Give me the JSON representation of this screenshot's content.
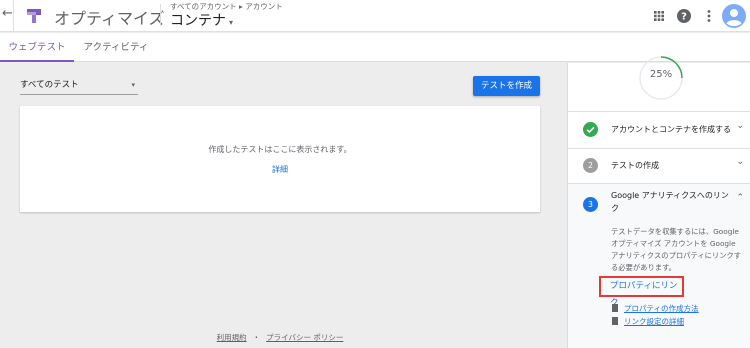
{
  "header": {
    "back_icon": "←",
    "brand": "オプティマイズ",
    "breadcrumb": "すべてのアカウント ▸ アカウント",
    "container_name": "コンテナ",
    "caret": "▾"
  },
  "tabs": [
    {
      "label": "ウェブテスト",
      "active": true
    },
    {
      "label": "アクティビティ",
      "active": false
    }
  ],
  "main": {
    "filter_value": "すべてのテスト",
    "filter_caret": "▾",
    "create_button": "テストを作成",
    "empty_message": "作成したテストはここに表示されます。",
    "detail_link": "詳細"
  },
  "footer": {
    "terms": "利用規約",
    "separator": "・",
    "privacy": "プライバシー ポリシー"
  },
  "panel": {
    "progress_label": "25%",
    "progress_value": 0.25,
    "steps": [
      {
        "number": "",
        "label": "アカウントとコンテナを作成する",
        "status": "done",
        "chevron": "⌄"
      },
      {
        "number": "2",
        "label": "テストの作成",
        "status": "pending",
        "chevron": "⌄"
      },
      {
        "number": "3",
        "label": "Google アナリティクスへのリンク",
        "status": "current",
        "chevron": "⌃"
      }
    ],
    "step3_description": "テストデータを収集するには、Google オプティマイズ アカウントを Google アナリティクスのプロパティにリンクする必要があります。",
    "link_property_button": "プロパティにリンク",
    "doc_links": [
      "プロパティの作成方法",
      "リンク設定の詳細"
    ]
  },
  "colors": {
    "accent": "#7e57c2",
    "primary": "#1a73e8",
    "success": "#34a853",
    "highlight": "#e53935"
  }
}
